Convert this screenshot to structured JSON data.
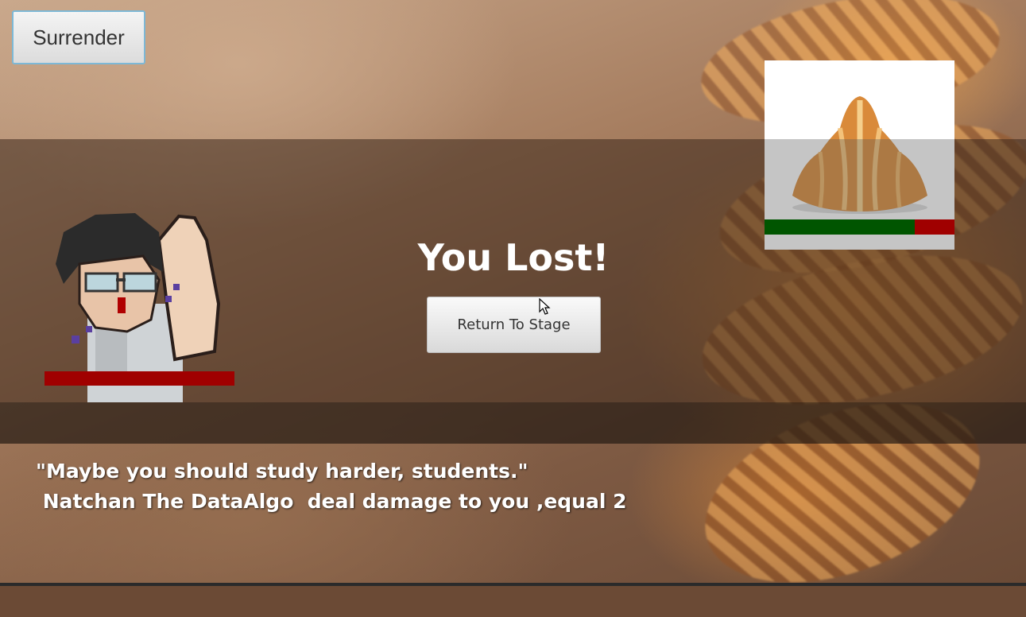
{
  "buttons": {
    "surrender": "Surrender",
    "return_to_stage": "Return To Stage"
  },
  "result": {
    "title": "You Lost!"
  },
  "dialog": {
    "quote": "\"Maybe you should study harder, students.\"",
    "damage_line": " Natchan The DataAlgo  deal damage to you ,equal 2"
  },
  "player": {
    "sprite_icon": "pixel-student-character",
    "hp_fraction": 0.0,
    "hp_color": "#a00000"
  },
  "enemy": {
    "sprite_icon": "croissant-image",
    "hp_fraction": 0.79,
    "hp_color": "#005500",
    "damage_color": "#a00000"
  },
  "colors": {
    "overlay_band": "#3c281c",
    "button_border": "#7db8d6"
  }
}
